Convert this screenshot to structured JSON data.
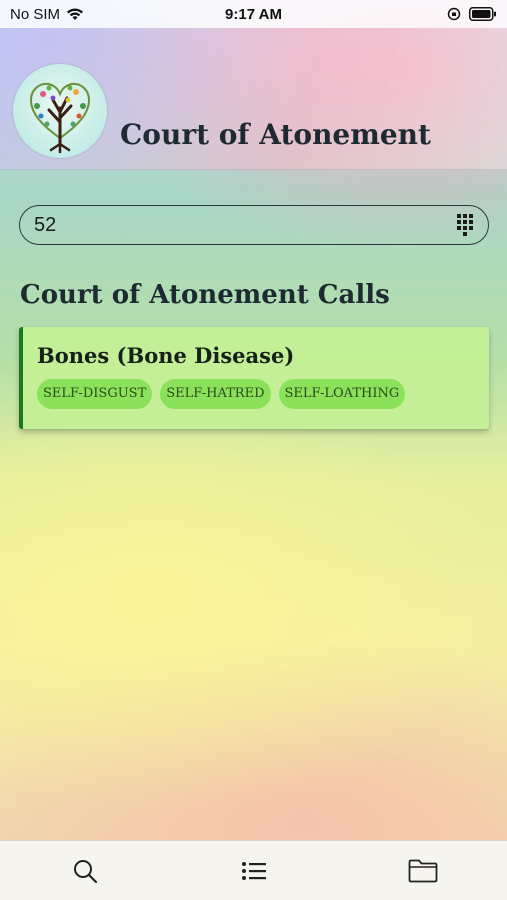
{
  "status_bar": {
    "carrier": "No SIM",
    "time": "9:17 AM"
  },
  "header": {
    "app_title": "Court of Atonement",
    "logo_icon": "tree-of-life-heart-logo"
  },
  "search": {
    "value": "52",
    "keypad_icon": "keypad-icon"
  },
  "section": {
    "title": "Court of Atonement Calls"
  },
  "results": [
    {
      "title": "Bones (Bone Disease)",
      "tags": [
        "SELF-DISGUST",
        "SELF-HATRED",
        "SELF-LOATHING"
      ]
    }
  ],
  "tab_bar": {
    "items": [
      "search-icon",
      "list-icon",
      "folder-icon"
    ]
  },
  "colors": {
    "card_bg": "#c4f096",
    "card_accent": "#1c7a1c",
    "tag_bg": "#8be25a"
  }
}
